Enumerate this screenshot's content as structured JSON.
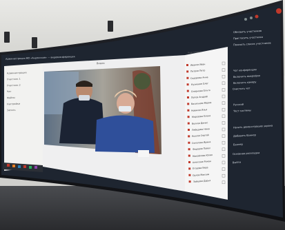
{
  "window": {
    "title": "Администрация МО «Андомское» — видеоконференция",
    "video_panel_title": "Видео",
    "participants_header": "Участники"
  },
  "sidebar_left": {
    "lines": [
      "Администрация",
      "Участник 1",
      "Участник 2",
      "Чат",
      "Файлы",
      "Настройки",
      "Запись"
    ]
  },
  "participants": [
    "Иванов Иван",
    "Петров Петр",
    "Сидорова Анна",
    "Кузнецов Олег",
    "Смирнова Ольга",
    "Попов Андрей",
    "Васильева Мария",
    "Новиков Илья",
    "Морозова Елена",
    "Волков Денис",
    "Лебедева Нина",
    "Козлов Сергей",
    "Соколова Ирина",
    "Федоров Павел",
    "Михайлова Юлия",
    "Алексеев Роман",
    "Егорова Вера",
    "Орлов Максим",
    "Зайцева Дарья"
  ],
  "right_menu": {
    "top_items": [
      "Обновить участников",
      "Пригласить участника",
      "Показать список участников"
    ],
    "mid_items": [
      "Чат конференции",
      "Включить микрофон",
      "Включить камеру",
      "Очистить чат"
    ],
    "lang_items": [
      "Русский",
      "Тест системы"
    ],
    "bottom_items": [
      "Начать демонстрацию экрана",
      "Добавить баннер",
      "Баннер",
      "Основная раскладка",
      "Выйти"
    ]
  },
  "colors": {
    "screen_frame": "#1a1b1f",
    "app_bg_dark": "#1e2530",
    "app_panel_light": "#f3f3f3",
    "video_bg": "#7a8a9a",
    "accent_red": "#c0392b",
    "taskbar": "#2b2f36"
  },
  "icons": {
    "left_sidebar": "list-icon",
    "participant_status": "red-dot-icon",
    "checkbox": "checkbox-icon",
    "close": "close-icon"
  }
}
